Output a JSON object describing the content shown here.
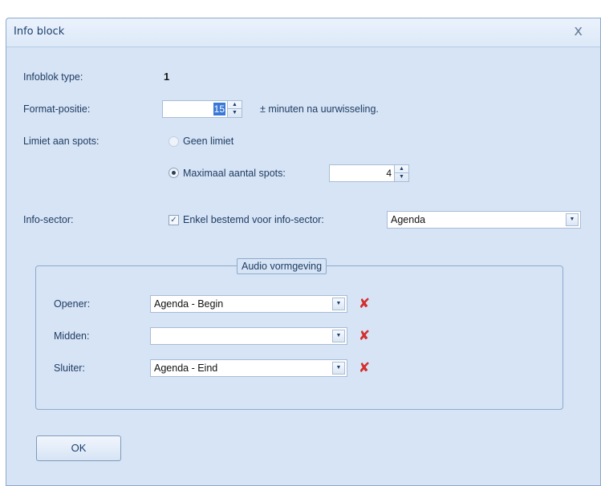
{
  "window": {
    "title": "Info block",
    "close_glyph": "x"
  },
  "fields": {
    "infoblok_type": {
      "label": "Infoblok type:",
      "value": "1"
    },
    "format_positie": {
      "label": "Format-positie:",
      "value": "15",
      "suffix": "± minuten na uurwisseling."
    },
    "limiet": {
      "label": "Limiet aan spots:",
      "option_none": "Geen limiet",
      "option_max": "Maximaal aantal spots:",
      "max_value": "4",
      "selected": "max"
    },
    "info_sector": {
      "label": "Info-sector:",
      "checkbox_label": "Enkel bestemd voor info-sector:",
      "checked": true,
      "value": "Agenda"
    }
  },
  "audio_group": {
    "title": "Audio vormgeving",
    "rows": [
      {
        "label": "Opener:",
        "value": "Agenda - Begin"
      },
      {
        "label": "Midden:",
        "value": ""
      },
      {
        "label": "Sluiter:",
        "value": "Agenda - Eind"
      }
    ]
  },
  "buttons": {
    "ok": "OK"
  },
  "icons": {
    "close": "close-icon",
    "delete": "delete-x-icon",
    "dropdown": "chevron-down-icon",
    "spin": "spin-updown-icon"
  },
  "colors": {
    "window_bg": "#d6e4f5",
    "border": "#8eaacb",
    "delete_red": "#d32f2f",
    "selection": "#3a78d8"
  }
}
